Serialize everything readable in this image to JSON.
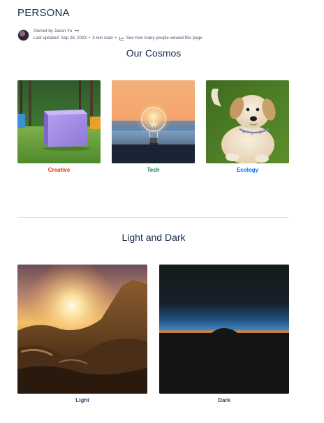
{
  "page": {
    "title": "PERSONA"
  },
  "byline": {
    "owner": "Owned by Jason Yu",
    "more_icon": "•••",
    "last_updated": "Last updated: Sep 26, 2023",
    "read_time": "3 min read",
    "views_link": "See how many people viewed this page",
    "separator": "•"
  },
  "sections": [
    {
      "heading": "Our Cosmos",
      "cards": [
        {
          "label": "Creative",
          "color": "#de350b"
        },
        {
          "label": "Tech",
          "color": "#00875a"
        },
        {
          "label": "Ecology",
          "color": "#0065ff"
        }
      ]
    },
    {
      "heading": "Light and Dark",
      "cards": [
        {
          "label": "Light",
          "color": "#344563"
        },
        {
          "label": "Dark",
          "color": "#344563"
        }
      ]
    }
  ]
}
